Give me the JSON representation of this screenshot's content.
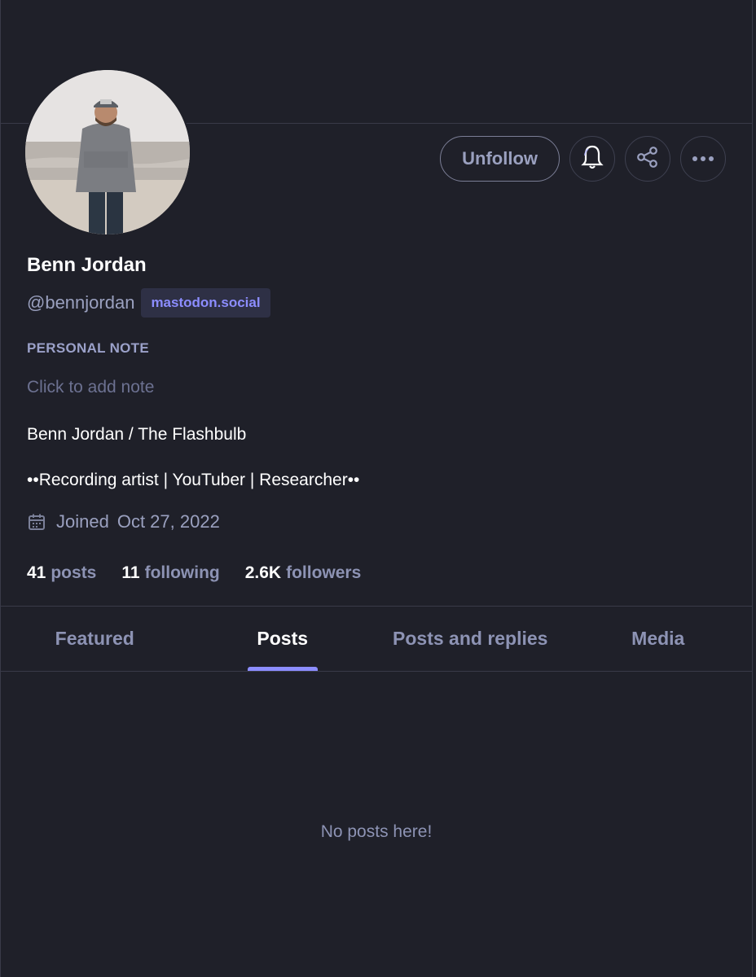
{
  "profile": {
    "display_name": "Benn Jordan",
    "handle": "@bennjordan",
    "domain": "mastodon.social"
  },
  "actions": {
    "unfollow_label": "Unfollow",
    "notify_icon": "bell-icon",
    "share_icon": "share-icon",
    "more_icon": "more-icon"
  },
  "note": {
    "label": "PERSONAL NOTE",
    "placeholder": "Click to add note"
  },
  "bio": {
    "line1": "Benn Jordan / The Flashbulb",
    "line2": "••Recording artist | YouTuber | Researcher••"
  },
  "joined": {
    "label": "Joined",
    "date": "Oct 27, 2022"
  },
  "stats": [
    {
      "count": "41",
      "label": "posts"
    },
    {
      "count": "11",
      "label": "following"
    },
    {
      "count": "2.6K",
      "label": "followers"
    }
  ],
  "tabs": [
    {
      "label": "Featured"
    },
    {
      "label": "Posts"
    },
    {
      "label": "Posts and replies"
    },
    {
      "label": "Media"
    }
  ],
  "active_tab": "Posts",
  "empty_message": "No posts here!",
  "colors": {
    "background": "#1f2029",
    "accent": "#8c8dff",
    "muted_text": "#9aa0bf"
  }
}
